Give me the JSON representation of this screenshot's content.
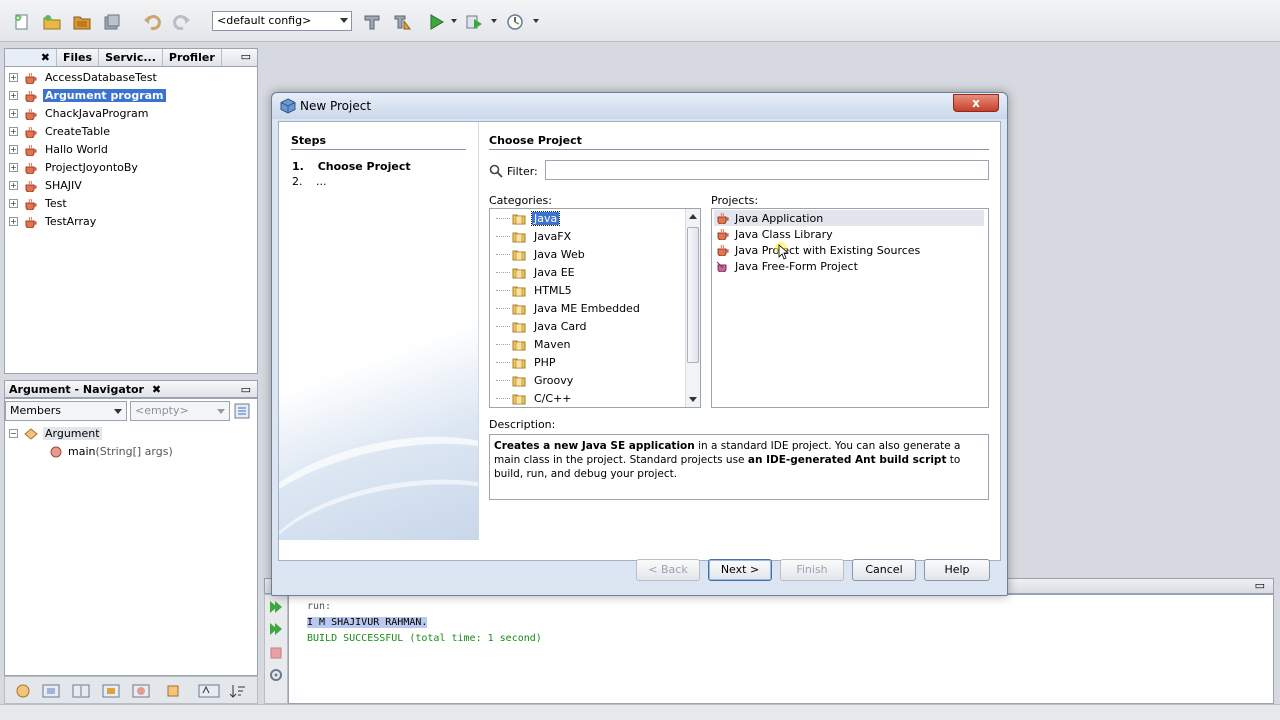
{
  "toolbar": {
    "config_value": "<default config>",
    "icons": [
      "new-file-icon",
      "new-project-icon",
      "open-project-icon",
      "save-all-icon",
      "undo-icon",
      "redo-icon",
      "build-icon",
      "clean-build-icon",
      "run-icon",
      "debug-icon",
      "profile-icon"
    ]
  },
  "projects_panel": {
    "tabs": [
      "Files",
      "Servic...",
      "Profiler"
    ],
    "items": [
      {
        "label": "AccessDatabaseTest",
        "selected": false
      },
      {
        "label": "Argument program",
        "selected": true
      },
      {
        "label": "ChackJavaProgram",
        "selected": false
      },
      {
        "label": "CreateTable",
        "selected": false
      },
      {
        "label": "Hallo World",
        "selected": false
      },
      {
        "label": "ProjectJoyontoBy",
        "selected": false
      },
      {
        "label": "SHAJIV",
        "selected": false
      },
      {
        "label": "Test",
        "selected": false
      },
      {
        "label": "TestArray",
        "selected": false
      }
    ]
  },
  "navigator": {
    "title": "Argument - Navigator",
    "members_select": "Members",
    "filter_select": "<empty>",
    "root": "Argument",
    "method_name": "main",
    "method_params": "(String[] args)"
  },
  "output": {
    "lines": [
      "run:",
      "I M SHAJIVUR RAHMAN.",
      "BUILD SUCCESSFUL (total time: 1 second)"
    ]
  },
  "dialog": {
    "title": "New Project",
    "close_label": "x",
    "steps_title": "Steps",
    "steps": [
      {
        "num": "1.",
        "label": "Choose Project"
      },
      {
        "num": "2.",
        "label": "..."
      }
    ],
    "main_title": "Choose Project",
    "filter_label": "Filter:",
    "filter_value": "",
    "categories_label": "Categories:",
    "categories": [
      {
        "label": "Java",
        "selected": true
      },
      {
        "label": "JavaFX",
        "selected": false
      },
      {
        "label": "Java Web",
        "selected": false
      },
      {
        "label": "Java EE",
        "selected": false
      },
      {
        "label": "HTML5",
        "selected": false
      },
      {
        "label": "Java ME Embedded",
        "selected": false
      },
      {
        "label": "Java Card",
        "selected": false
      },
      {
        "label": "Maven",
        "selected": false
      },
      {
        "label": "PHP",
        "selected": false
      },
      {
        "label": "Groovy",
        "selected": false
      },
      {
        "label": "C/C++",
        "selected": false
      }
    ],
    "projects_label": "Projects:",
    "projects": [
      {
        "label": "Java Application",
        "selected": true
      },
      {
        "label": "Java Class Library",
        "selected": false
      },
      {
        "label": "Java Project with Existing Sources",
        "selected": false
      },
      {
        "label": "Java Free-Form Project",
        "selected": false
      }
    ],
    "description_label": "Description:",
    "description": {
      "b1": "Creates a new Java SE application",
      "t1": " in a standard IDE project. You can also generate a main class in the project. Standard projects use ",
      "b2": "an IDE-generated Ant build script",
      "t2": " to build, run, and debug your project."
    },
    "buttons": {
      "back": "< Back",
      "next": "Next >",
      "finish": "Finish",
      "cancel": "Cancel",
      "help": "Help"
    }
  },
  "colors": {
    "selection": "#3b73d1",
    "build_success": "#1a8a1a",
    "close_button": "#c4412a"
  }
}
